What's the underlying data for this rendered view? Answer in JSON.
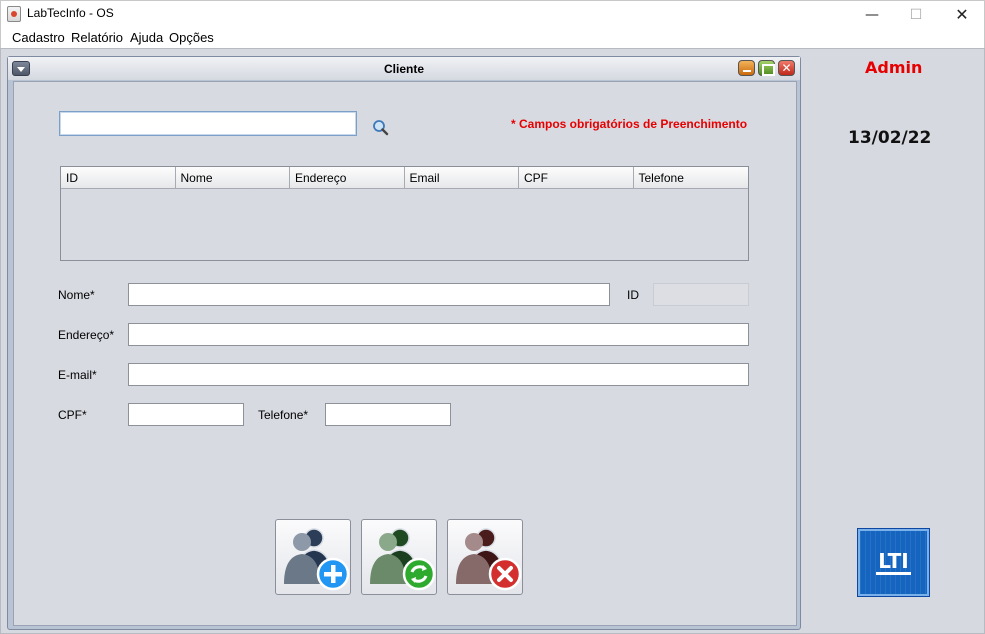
{
  "window": {
    "title": "LabTecInfo - OS"
  },
  "menu": {
    "items": [
      "Cadastro",
      "Relatório",
      "Ajuda",
      "Opções"
    ]
  },
  "side": {
    "user": "Admin",
    "date": "13/02/22",
    "logo_text": "LTI"
  },
  "frame": {
    "title": "Cliente",
    "search": {
      "value": "",
      "placeholder": ""
    },
    "required_note": "* Campos obrigatórios de Preenchimento",
    "table": {
      "columns": [
        "ID",
        "Nome",
        "Endereço",
        "Email",
        "CPF",
        "Telefone"
      ],
      "rows": []
    },
    "form": {
      "nome_label": "Nome*",
      "id_label": "ID",
      "endereco_label": "Endereço*",
      "email_label": "E-mail*",
      "cpf_label": "CPF*",
      "telefone_label": "Telefone*",
      "nome_value": "",
      "id_value": "",
      "endereco_value": "",
      "email_value": "",
      "cpf_value": "",
      "telefone_value": ""
    },
    "buttons": {
      "add_icon": "add-user-icon",
      "update_icon": "update-user-icon",
      "delete_icon": "delete-user-icon"
    }
  },
  "colors": {
    "required": "#e60000",
    "desktop": "#d7d9e1",
    "add": "#1e88e5",
    "update": "#2e9e2e",
    "delete": "#d32f2f"
  }
}
